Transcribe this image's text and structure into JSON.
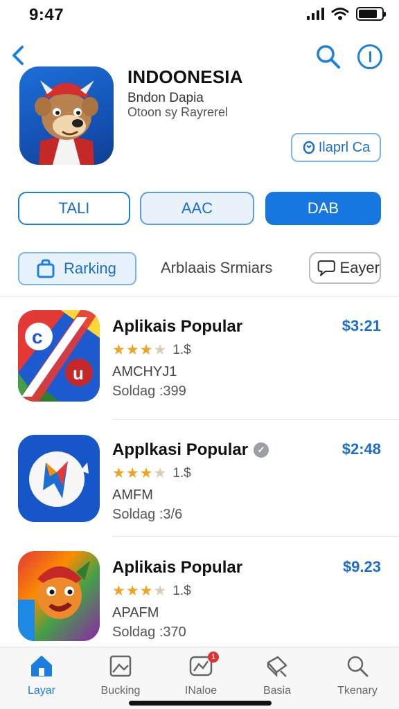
{
  "status": {
    "time": "9:47"
  },
  "header": {
    "app_title": "INDOONESIA",
    "subtitle1": "Bndon Dapia",
    "subtitle2": "Otoon sy Rayrerel",
    "open_button": "Ilaprl Ca"
  },
  "segments": [
    "TALI",
    "AAC",
    "DAB"
  ],
  "filters": {
    "ranking": "Rarking",
    "middle": "Arblaais Srmiars",
    "chat": "Eayer"
  },
  "apps": [
    {
      "name": "Aplikais Popular",
      "price": "$3:21",
      "rating_text": "1.$",
      "rating": 3.5,
      "developer": "AMCHYJ1",
      "sold": "Soldag :399",
      "badge": false
    },
    {
      "name": "Applkasi Popular",
      "price": "$2:48",
      "rating_text": "1.$",
      "rating": 3.5,
      "developer": "AMFM",
      "sold": "Soldag :3/6",
      "badge": true
    },
    {
      "name": "Aplikais Popular",
      "price": "$9.23",
      "rating_text": "1.$",
      "rating": 3.5,
      "developer": "APAFM",
      "sold": "Soldag :370",
      "badge": false
    }
  ],
  "tabs": [
    {
      "label": "Layar",
      "icon": "home-icon",
      "active": true
    },
    {
      "label": "Bucking",
      "icon": "image-icon",
      "active": false
    },
    {
      "label": "INaloe",
      "icon": "chart-icon",
      "active": false,
      "badge": "1"
    },
    {
      "label": "Basia",
      "icon": "book-icon",
      "active": false
    },
    {
      "label": "Tkenary",
      "icon": "search-icon",
      "active": false
    }
  ],
  "colors": {
    "accent": "#1a7fe0",
    "price": "#1a6ecc",
    "star": "#f0a31e"
  }
}
